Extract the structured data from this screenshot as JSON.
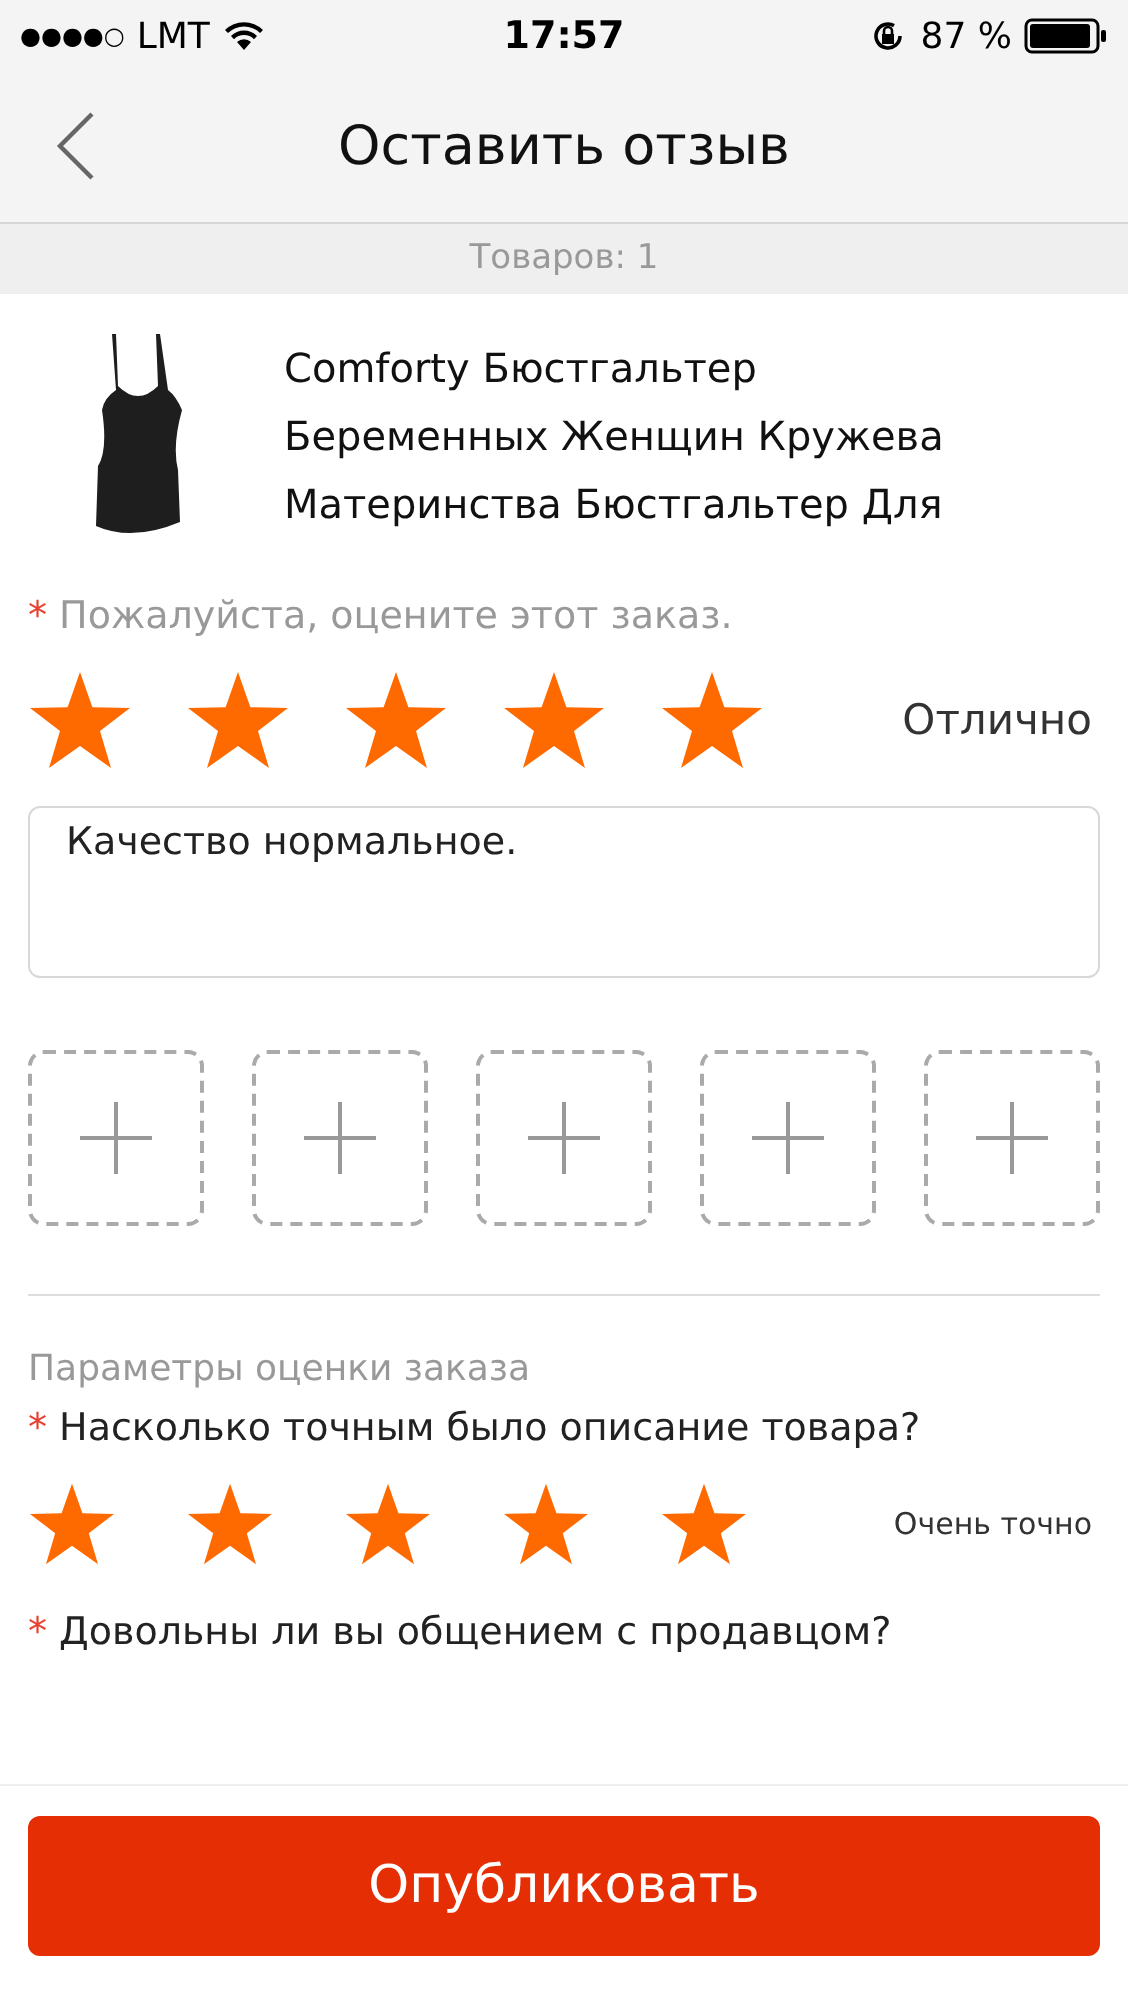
{
  "status_bar": {
    "signal_dots": "●●●●○",
    "carrier": "LMT",
    "time": "17:57",
    "battery_percent": "87 %"
  },
  "nav": {
    "title": "Оставить отзыв"
  },
  "items_count": "Товаров: 1",
  "product": {
    "title": "Comforty Бюстгальтер Беременных Женщин Кружева Материнства Бюстгальтер Для"
  },
  "overall": {
    "required_mark": "*",
    "prompt": "Пожалуйста, оцените этот заказ.",
    "stars": 5,
    "rating_label": "Отлично"
  },
  "review": {
    "value": "Качество нормальное."
  },
  "photo_slots": [
    {
      "kind": "add"
    },
    {
      "kind": "add"
    },
    {
      "kind": "add"
    },
    {
      "kind": "add"
    },
    {
      "kind": "add"
    }
  ],
  "parameters": {
    "title": "Параметры оценки заказа",
    "questions": [
      {
        "required_mark": "*",
        "question": "Насколько точным было описание товара?",
        "stars": 5,
        "rating_label": "Очень точно"
      },
      {
        "required_mark": "*",
        "question": "Довольны ли вы общением с продавцом?"
      }
    ]
  },
  "publish_button": "Опубликовать"
}
